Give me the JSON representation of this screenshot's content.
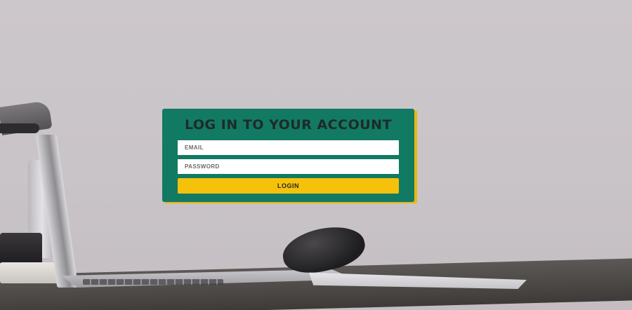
{
  "login": {
    "title": "LOG IN TO YOUR ACCOUNT",
    "email_placeholder": "EMAIL",
    "email_value": "",
    "password_placeholder": "PASSWORD",
    "password_value": "",
    "button_label": "LOGIN"
  },
  "colors": {
    "card_background": "#127a62",
    "card_accent": "#e9b80c",
    "button_background": "#f5c10b",
    "title_text": "#1e2a2c"
  }
}
